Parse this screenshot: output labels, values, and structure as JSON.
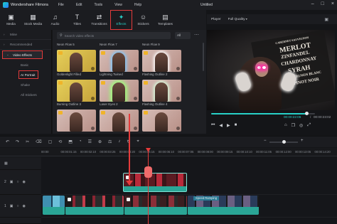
{
  "app": {
    "name": "Wondershare Filmora",
    "doc_title": "Untitled"
  },
  "menu": [
    "File",
    "Edit",
    "Tools",
    "View",
    "Help"
  ],
  "toolbar": {
    "tabs": [
      {
        "label": "Media",
        "icon": "media-icon",
        "glyph": "▣"
      },
      {
        "label": "Stock Media",
        "icon": "stock-media-icon",
        "glyph": "▦"
      },
      {
        "label": "Audio",
        "icon": "audio-icon",
        "glyph": "♫"
      },
      {
        "label": "Titles",
        "icon": "titles-icon",
        "glyph": "T"
      },
      {
        "label": "Transitions",
        "icon": "transitions-icon",
        "glyph": "⇄"
      },
      {
        "label": "Effects",
        "icon": "effects-icon",
        "glyph": "✦",
        "active": true
      },
      {
        "label": "Stickers",
        "icon": "stickers-icon",
        "glyph": "☺"
      },
      {
        "label": "Templates",
        "icon": "templates-icon",
        "glyph": "▤"
      }
    ]
  },
  "sidebar": {
    "categories": [
      {
        "label": "Mine",
        "chev": "›"
      },
      {
        "label": "Recommended",
        "chev": "›"
      },
      {
        "label": "Video Effects",
        "chev": "⌄",
        "selected": true
      }
    ],
    "subitems": [
      {
        "label": "Basic"
      },
      {
        "label": "AI Portrait",
        "selected": true
      },
      {
        "label": "Shake"
      },
      {
        "label": "All Stickers"
      }
    ]
  },
  "browser": {
    "search_placeholder": "Search video effects",
    "filter": "All",
    "more": "⋯",
    "top_captions": [
      "Neon Flow 5",
      "Neon Flow 7",
      "Neon Flow 9"
    ],
    "items": [
      {
        "label": "Goldenlight Filled",
        "style": "yellow"
      },
      {
        "label": "Lightning Twined",
        "style": "blue"
      },
      {
        "label": "Flashing Outline 2",
        "style": "white"
      },
      {
        "label": "Burning Outline 3",
        "style": "yellow"
      },
      {
        "label": "Laser Eyes 2",
        "style": "green"
      },
      {
        "label": "Flashing Outline 4",
        "style": "glow"
      },
      {
        "label": "",
        "style": "plain"
      },
      {
        "label": "",
        "style": "plain"
      },
      {
        "label": "",
        "style": "plain"
      }
    ]
  },
  "player": {
    "label": "Player",
    "quality": "Full Quality",
    "overlay_words": [
      "CABERNET SAUVIGNON",
      "MERLOT",
      "ZINFANDEL",
      "CHARDONNAY",
      "SYRAH",
      "SAUVIGNON BLANC",
      "PINOT NOIR"
    ],
    "current_time": "00:00:22:06",
    "separator": "/",
    "duration": "00:00:23:02",
    "progress": 0.92,
    "controls_left": [
      "⏮",
      "◀",
      "▶",
      "■"
    ],
    "controls_right": [
      "⌂",
      "❐",
      "◎",
      "⤢"
    ]
  },
  "timeline": {
    "tools": [
      "↶",
      "↷",
      "✂",
      "⌫",
      "▢",
      "⟲",
      "⬒",
      "◔",
      "☰",
      "⊕",
      "⚖",
      "♪",
      "↻",
      "⌖"
    ],
    "zoom_minus": "−",
    "zoom_plus": "+",
    "zoom_level": 0.45,
    "ruler": [
      "00:00",
      "00:00:01:15",
      "00:00:02:10",
      "00:00:03:25",
      "00:00:04:20",
      "00:00:05:15",
      "00:00:06:10",
      "00:00:07:05",
      "00:00:08:00",
      "00:00:09:15",
      "00:00:10:10",
      "00:00:11:05",
      "00:00:12:00",
      "00:00:13:05",
      "00:00:14:20"
    ],
    "track_heads": [
      {
        "num": "2",
        "icons": [
          "▣",
          "○",
          "◉"
        ]
      },
      {
        "num": "1",
        "icons": [
          "▣",
          "○",
          "◉"
        ]
      }
    ],
    "speed_label": "Speed Ramping"
  },
  "colors": {
    "accent": "#28d1c8",
    "highlight": "#e53b3b",
    "clip": "#2aa596"
  }
}
